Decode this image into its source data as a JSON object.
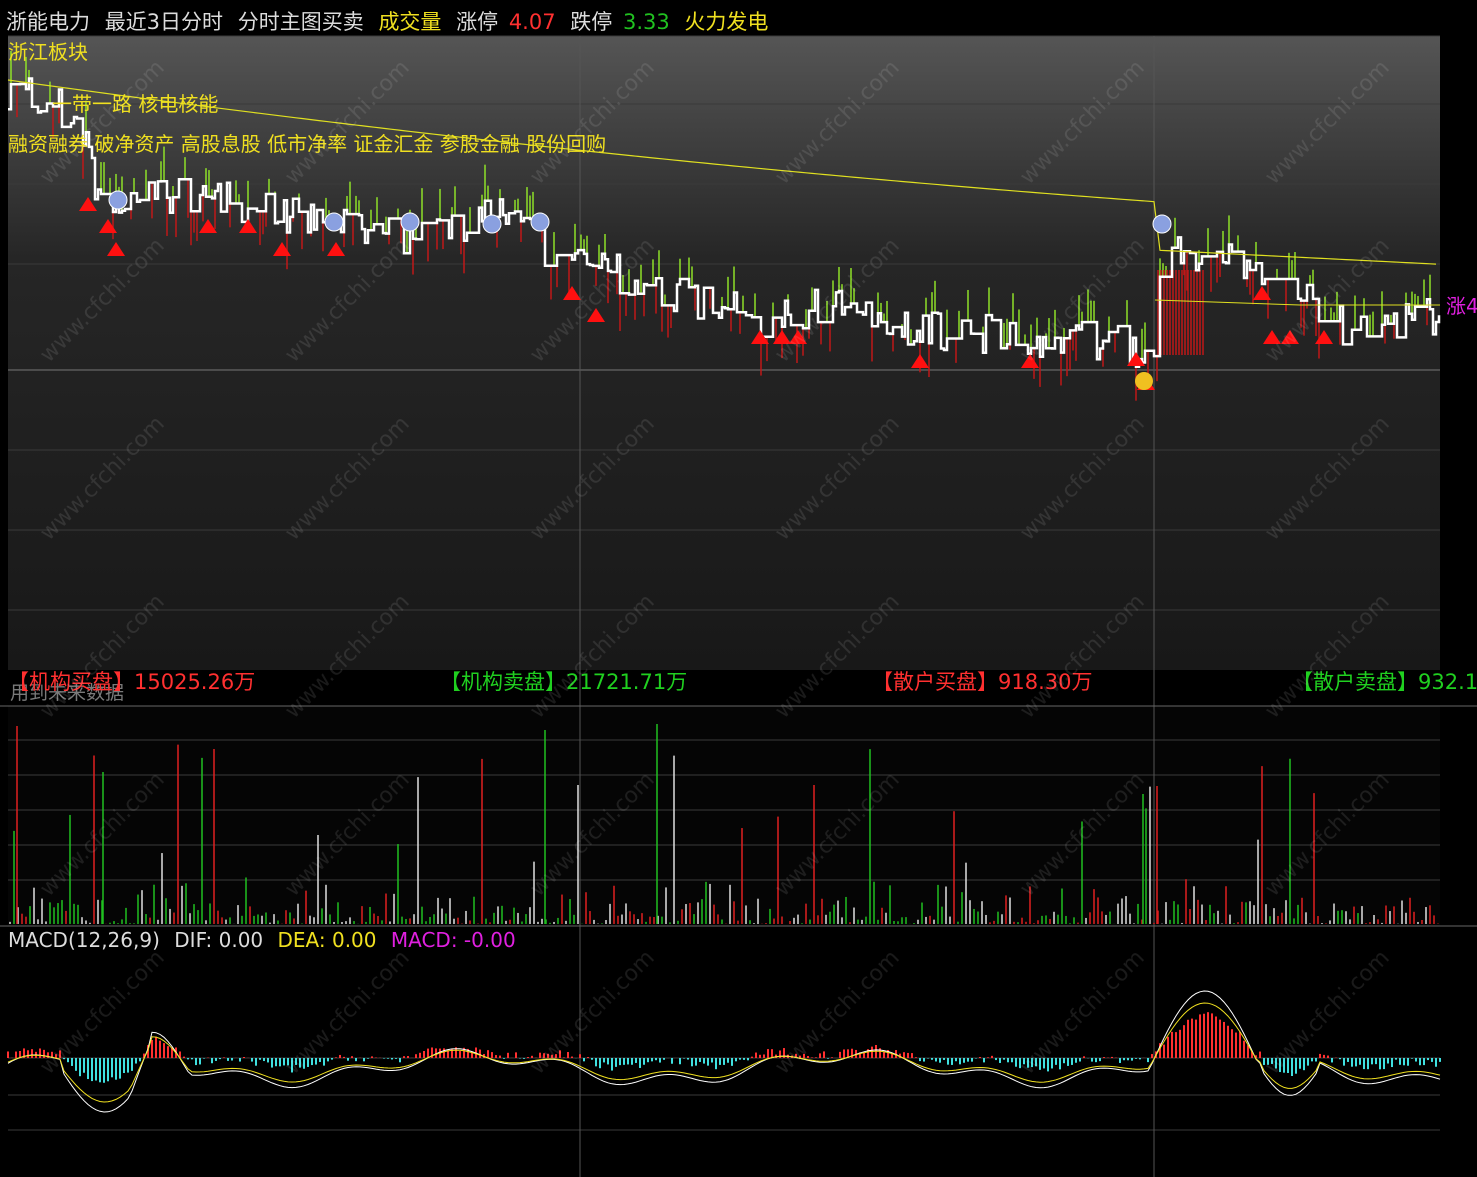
{
  "header": {
    "stock_name": "浙能电力",
    "period": "最近3日分时",
    "indicator": "分时主图买卖",
    "volume_label": "成交量",
    "limit_up_label": "涨停",
    "limit_up_value": "4.07",
    "limit_down_label": "跌停",
    "limit_down_value": "3.33",
    "sector": "火力发电"
  },
  "tags": {
    "line1": "浙江板块",
    "line2": "一带一路 核电核能",
    "line3": "融资融券 破净资产 高股息股 低市净率 证金汇金 参股金融 股份回购"
  },
  "side_label": "涨4",
  "fund_flow": {
    "inst_buy": "【机构买盘】15025.26万",
    "inst_sell": "【机构卖盘】21721.71万",
    "retail_buy": "【散户买盘】918.30万",
    "retail_sell": "【散户卖盘】932.1"
  },
  "volume_panel": {
    "title": "用到未来数据"
  },
  "macd": {
    "label": "MACD(12,26,9)",
    "dif": "DIF: 0.00",
    "dea": "DEA: 0.00",
    "macd": "MACD: -0.00"
  },
  "watermark": "www.cfchi.com",
  "colors": {
    "up": "#ff3030",
    "down": "#20c020",
    "price": "#ffffff",
    "avg": "#e0e020",
    "macd_pos": "#ff3030",
    "macd_neg": "#40e0e0",
    "dea": "#f0e020",
    "macd_value": "#e020e0",
    "buy_arrow": "#ff1010",
    "grid": "#3a3a3a"
  }
}
